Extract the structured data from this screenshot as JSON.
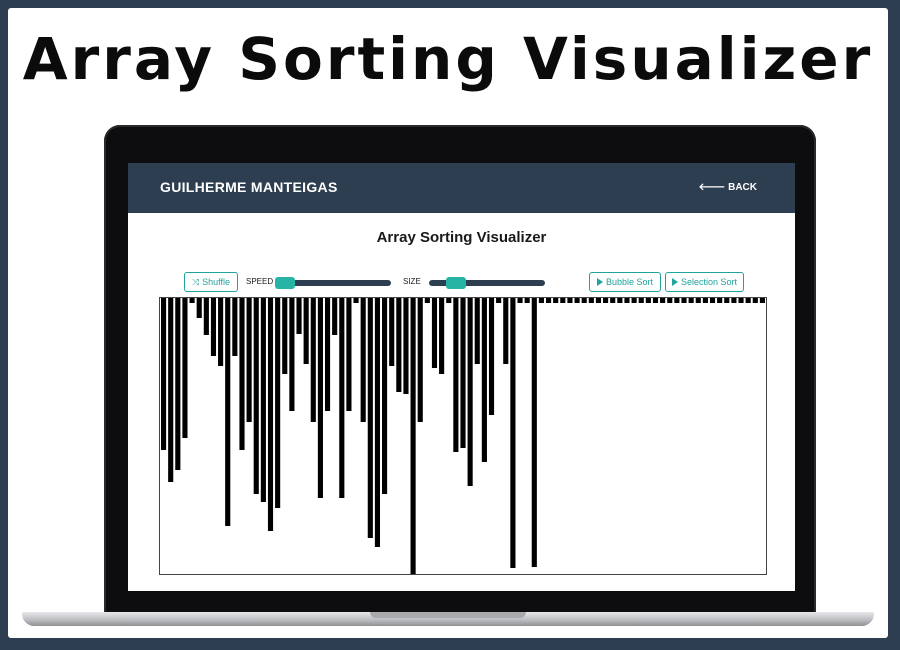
{
  "hero_title": "Array Sorting Visualizer",
  "navbar": {
    "brand": "GUILHERME MANTEIGAS",
    "back_label": "🡐 BACK"
  },
  "app": {
    "title": "Array Sorting Visualizer",
    "shuffle_label": "Shuffle",
    "speed_label": "SPEED",
    "size_label": "SIZE",
    "bubble_label": "Bubble Sort",
    "selection_label": "Selection Sort"
  },
  "controls": {
    "speed_fraction": 0.0,
    "size_fraction": 0.18
  },
  "colors": {
    "accent": "#20a39e",
    "nav": "#2c3e50",
    "bar": "#000000"
  },
  "icons": {
    "shuffle": "shuffle-icon",
    "play": "play-icon",
    "back": "arrow-left-icon"
  },
  "bars": [
    152,
    184,
    172,
    140,
    5,
    20,
    37,
    58,
    68,
    228,
    58,
    152,
    124,
    196,
    204,
    233,
    210,
    76,
    113,
    36,
    66,
    124,
    200,
    113,
    37,
    200,
    113,
    5,
    124,
    240,
    249,
    196,
    68,
    94,
    96,
    276,
    124,
    5,
    70,
    76,
    5,
    154,
    150,
    188,
    66,
    164,
    117,
    5,
    66,
    270,
    5,
    5,
    269,
    5,
    5,
    5,
    5,
    5,
    5,
    5,
    5,
    5,
    5,
    5,
    5,
    5,
    5,
    5,
    5,
    5,
    5,
    5,
    5,
    5,
    5,
    5,
    5,
    5,
    5,
    5,
    5,
    5,
    5,
    5,
    5
  ]
}
